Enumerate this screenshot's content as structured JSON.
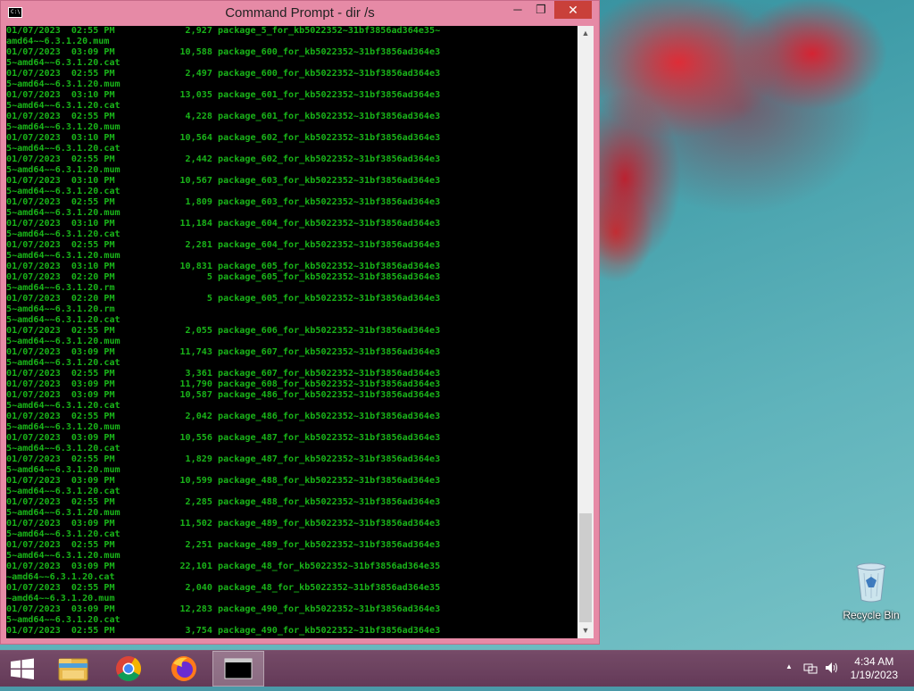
{
  "window": {
    "title": "Command Prompt - dir  /s",
    "minimize_glyph": "─",
    "maximize_glyph": "❐",
    "close_glyph": "✕"
  },
  "console": {
    "lines": [
      "01/07/2023  02:55 PM             2,927 package_5_for_kb5022352~31bf3856ad364e35~",
      "amd64~~6.3.1.20.mum",
      "01/07/2023  03:09 PM            10,588 package_600_for_kb5022352~31bf3856ad364e3",
      "5~amd64~~6.3.1.20.cat",
      "01/07/2023  02:55 PM             2,497 package_600_for_kb5022352~31bf3856ad364e3",
      "5~amd64~~6.3.1.20.mum",
      "01/07/2023  03:10 PM            13,035 package_601_for_kb5022352~31bf3856ad364e3",
      "5~amd64~~6.3.1.20.cat",
      "01/07/2023  02:55 PM             4,228 package_601_for_kb5022352~31bf3856ad364e3",
      "5~amd64~~6.3.1.20.mum",
      "01/07/2023  03:10 PM            10,564 package_602_for_kb5022352~31bf3856ad364e3",
      "5~amd64~~6.3.1.20.cat",
      "01/07/2023  02:55 PM             2,442 package_602_for_kb5022352~31bf3856ad364e3",
      "5~amd64~~6.3.1.20.mum",
      "01/07/2023  03:10 PM            10,567 package_603_for_kb5022352~31bf3856ad364e3",
      "5~amd64~~6.3.1.20.cat",
      "01/07/2023  02:55 PM             1,809 package_603_for_kb5022352~31bf3856ad364e3",
      "5~amd64~~6.3.1.20.mum",
      "01/07/2023  03:10 PM            11,184 package_604_for_kb5022352~31bf3856ad364e3",
      "5~amd64~~6.3.1.20.cat",
      "01/07/2023  02:55 PM             2,281 package_604_for_kb5022352~31bf3856ad364e3",
      "5~amd64~~6.3.1.20.mum",
      "01/07/2023  03:10 PM            10,831 package_605_for_kb5022352~31bf3856ad364e3",
      "01/07/2023  02:20 PM                 5 package_605_for_kb5022352~31bf3856ad364e3",
      "5~amd64~~6.3.1.20.rm",
      "01/07/2023  02:20 PM                 5 package_605_for_kb5022352~31bf3856ad364e3",
      "5~amd64~~6.3.1.20.rm",
      "5~amd64~~6.3.1.20.cat",
      "01/07/2023  02:55 PM             2,055 package_606_for_kb5022352~31bf3856ad364e3",
      "5~amd64~~6.3.1.20.mum",
      "01/07/2023  03:09 PM            11,743 package_607_for_kb5022352~31bf3856ad364e3",
      "5~amd64~~6.3.1.20.cat",
      "01/07/2023  02:55 PM             3,361 package_607_for_kb5022352~31bf3856ad364e3",
      "01/07/2023  03:09 PM            11,790 package_608_for_kb5022352~31bf3856ad364e3",
      "01/07/2023  03:09 PM            10,587 package_486_for_kb5022352~31bf3856ad364e3",
      "5~amd64~~6.3.1.20.cat",
      "01/07/2023  02:55 PM             2,042 package_486_for_kb5022352~31bf3856ad364e3",
      "5~amd64~~6.3.1.20.mum",
      "01/07/2023  03:09 PM            10,556 package_487_for_kb5022352~31bf3856ad364e3",
      "5~amd64~~6.3.1.20.cat",
      "01/07/2023  02:55 PM             1,829 package_487_for_kb5022352~31bf3856ad364e3",
      "5~amd64~~6.3.1.20.mum",
      "01/07/2023  03:09 PM            10,599 package_488_for_kb5022352~31bf3856ad364e3",
      "5~amd64~~6.3.1.20.cat",
      "01/07/2023  02:55 PM             2,285 package_488_for_kb5022352~31bf3856ad364e3",
      "5~amd64~~6.3.1.20.mum",
      "01/07/2023  03:09 PM            11,502 package_489_for_kb5022352~31bf3856ad364e3",
      "5~amd64~~6.3.1.20.cat",
      "01/07/2023  02:55 PM             2,251 package_489_for_kb5022352~31bf3856ad364e3",
      "5~amd64~~6.3.1.20.mum",
      "01/07/2023  03:09 PM            22,101 package_48_for_kb5022352~31bf3856ad364e35",
      "~amd64~~6.3.1.20.cat",
      "01/07/2023  02:55 PM             2,040 package_48_for_kb5022352~31bf3856ad364e35",
      "~amd64~~6.3.1.20.mum",
      "01/07/2023  03:09 PM            12,283 package_490_for_kb5022352~31bf3856ad364e3",
      "5~amd64~~6.3.1.20.cat",
      "01/07/2023  02:55 PM             3,754 package_490_for_kb5022352~31bf3856ad364e3"
    ]
  },
  "desktop": {
    "recycle_bin_label": "Recycle Bin",
    "recycle_bin_icon": "recycle-bin-icon"
  },
  "taskbar": {
    "start_icon": "windows-logo-icon",
    "pinned": [
      "file-explorer-icon",
      "chrome-icon",
      "firefox-icon",
      "command-prompt-icon"
    ],
    "cmd_thumb_text": "C:\\>_",
    "clock_time": "4:34 AM",
    "clock_date": "1/19/2023"
  },
  "colors": {
    "console_text": "#19b419",
    "console_bg": "#000000",
    "window_frame": "#e68aa6",
    "close_button": "#c9403a",
    "taskbar": "#6e3f5c"
  }
}
